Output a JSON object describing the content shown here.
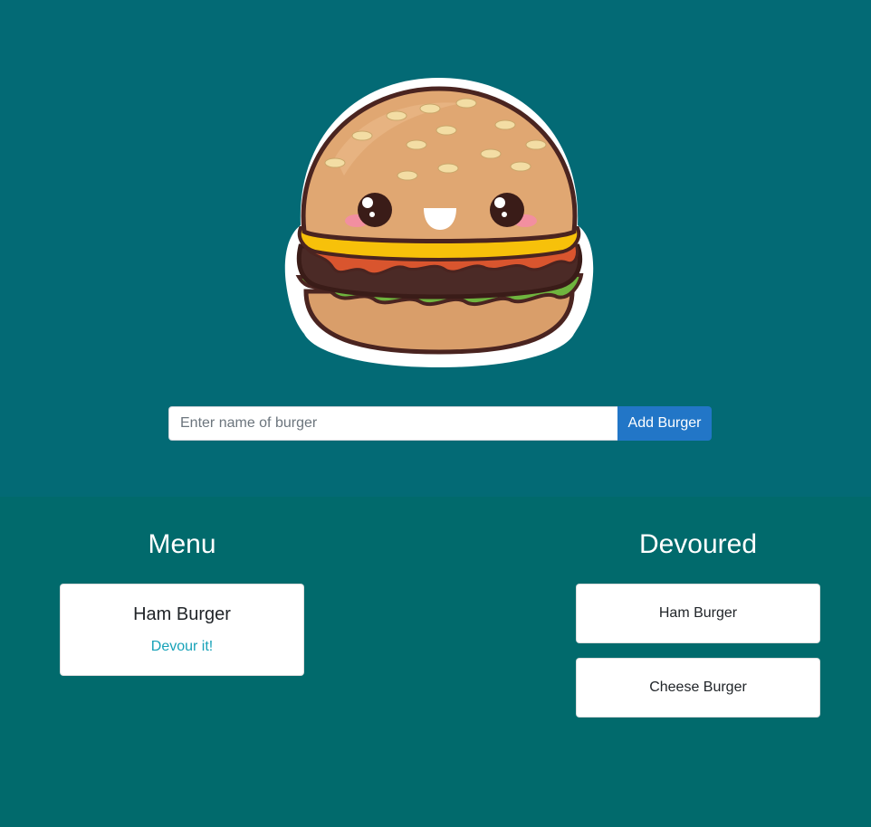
{
  "logo": {
    "icon": "smiling-burger-icon"
  },
  "form": {
    "placeholder": "Enter name of burger",
    "value": "",
    "button_label": "Add Burger"
  },
  "menu": {
    "title": "Menu",
    "items": [
      {
        "name": "Ham Burger",
        "action": "Devour it!"
      }
    ]
  },
  "devoured": {
    "title": "Devoured",
    "items": [
      {
        "name": "Ham Burger"
      },
      {
        "name": "Cheese Burger"
      }
    ]
  },
  "colors": {
    "top_background": "#036a75",
    "bottom_background": "#016a6c",
    "button": "#2276c7",
    "link": "#17a2b8"
  }
}
